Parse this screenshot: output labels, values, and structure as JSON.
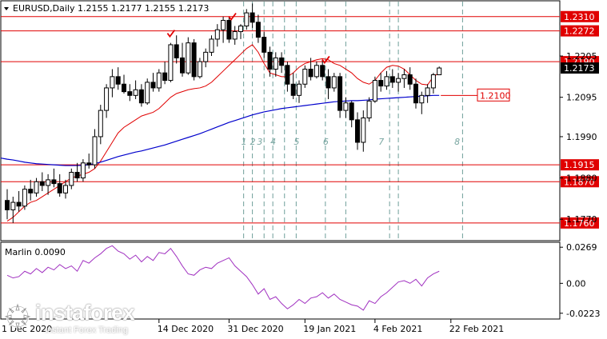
{
  "colors": {
    "background": "#ffffff",
    "axis": "#000000",
    "grid": "#c8c8c8",
    "level_line": "#e00000",
    "level_label_bg": "#e00000",
    "level_label_text": "#ffffff",
    "ma_line": "#0000cc",
    "envelope_line": "#e00000",
    "candle": "#000000",
    "marker": "#e00000",
    "wave_label": "#7aa7a2",
    "oscillator": "#a030c0",
    "price_label_bg": "#000000",
    "price_label_text": "#ffffff"
  },
  "icons": {
    "watermark_logo": "instaforex-logo-icon",
    "peak_marker": "check-mark-icon"
  },
  "chart_data": [
    {
      "type": "candlestick",
      "title": "EURUSD,Daily  1.2155 1.2177 1.2155 1.2173",
      "symbol": "EURUSD",
      "timeframe": "Daily",
      "ohlc_header": {
        "open": 1.2155,
        "high": 1.2177,
        "low": 1.2155,
        "close": 1.2173
      },
      "ylim": [
        1.1715,
        1.235
      ],
      "y_tick_labels": [
        {
          "value": 1.2205,
          "label": "1.2205"
        },
        {
          "value": 1.2095,
          "label": "1.2095"
        },
        {
          "value": 1.199,
          "label": "1.1990"
        },
        {
          "value": 1.188,
          "label": "1.1880"
        },
        {
          "value": 1.177,
          "label": "1.1770"
        }
      ],
      "x_labels": [
        "14 Dec 2020",
        "31 Dec 2020",
        "19 Jan 2021",
        "4 Feb 2021",
        "22 Feb 2021"
      ],
      "x_label_positions": [
        {
          "label": "14 Dec 2020",
          "index": 26
        },
        {
          "label": "31 Dec 2020",
          "index": 38
        },
        {
          "label": "19 Jan 2021",
          "index": 51
        },
        {
          "label": "4 Feb 2021",
          "index": 63
        },
        {
          "label": "22 Feb 2021",
          "index": 76
        }
      ],
      "levels": [
        {
          "value": 1.231,
          "label": "1.2310"
        },
        {
          "value": 1.2272,
          "label": "1.2272"
        },
        {
          "value": 1.219,
          "label": "1.2190"
        },
        {
          "value": 1.1915,
          "label": "1.1915"
        },
        {
          "value": 1.187,
          "label": "1.1870"
        },
        {
          "value": 1.176,
          "label": "1.1760"
        }
      ],
      "ma_label": {
        "value": 1.21,
        "label": "1.2100"
      },
      "last_price": {
        "value": 1.2173,
        "label": "1.2173"
      },
      "vertical_dividers_index": [
        40.5,
        42,
        44,
        45.5,
        47.5,
        49.5,
        54.5,
        58,
        65.5,
        67,
        78
      ],
      "wave_labels": [
        {
          "label": "1",
          "index": 40.5
        },
        {
          "label": "2",
          "index": 42
        },
        {
          "label": "3",
          "index": 43.2
        },
        {
          "label": "4",
          "index": 45.5
        },
        {
          "label": "5",
          "index": 49.5
        },
        {
          "label": "6",
          "index": 54.5
        },
        {
          "label": "7",
          "index": 64
        },
        {
          "label": "8",
          "index": 77
        }
      ],
      "peak_markers_index": [
        28,
        38.5,
        54.5
      ],
      "candles": [
        [
          1.182,
          1.185,
          1.177,
          1.1795
        ],
        [
          1.1795,
          1.183,
          1.176,
          1.1815
        ],
        [
          1.1815,
          1.1845,
          1.179,
          1.1805
        ],
        [
          1.1805,
          1.186,
          1.1795,
          1.185
        ],
        [
          1.185,
          1.1875,
          1.182,
          1.184
        ],
        [
          1.184,
          1.188,
          1.183,
          1.187
        ],
        [
          1.187,
          1.1895,
          1.1845,
          1.186
        ],
        [
          1.186,
          1.189,
          1.1835,
          1.1875
        ],
        [
          1.1875,
          1.1905,
          1.1855,
          1.1865
        ],
        [
          1.1865,
          1.189,
          1.183,
          1.184
        ],
        [
          1.184,
          1.1875,
          1.1825,
          1.186
        ],
        [
          1.186,
          1.1905,
          1.185,
          1.1895
        ],
        [
          1.1895,
          1.192,
          1.187,
          1.188
        ],
        [
          1.188,
          1.193,
          1.187,
          1.192
        ],
        [
          1.192,
          1.1945,
          1.1905,
          1.1915
        ],
        [
          1.1915,
          1.201,
          1.1905,
          1.199
        ],
        [
          1.199,
          1.2075,
          1.197,
          1.206
        ],
        [
          1.206,
          1.213,
          1.204,
          1.212
        ],
        [
          1.212,
          1.217,
          1.2095,
          1.215
        ],
        [
          1.215,
          1.2175,
          1.2115,
          1.213
        ],
        [
          1.213,
          1.2155,
          1.2105,
          1.211
        ],
        [
          1.211,
          1.213,
          1.2085,
          1.21
        ],
        [
          1.21,
          1.214,
          1.209,
          1.2115
        ],
        [
          1.2115,
          1.213,
          1.207,
          1.208
        ],
        [
          1.208,
          1.2145,
          1.2075,
          1.2135
        ],
        [
          1.2135,
          1.216,
          1.211,
          1.212
        ],
        [
          1.212,
          1.217,
          1.211,
          1.216
        ],
        [
          1.216,
          1.219,
          1.213,
          1.214
        ],
        [
          1.214,
          1.224,
          1.2135,
          1.2235
        ],
        [
          1.2235,
          1.226,
          1.2185,
          1.22
        ],
        [
          1.22,
          1.224,
          1.215,
          1.216
        ],
        [
          1.216,
          1.2255,
          1.2155,
          1.224
        ],
        [
          1.224,
          1.225,
          1.214,
          1.215
        ],
        [
          1.215,
          1.22,
          1.2145,
          1.219
        ],
        [
          1.219,
          1.2225,
          1.2175,
          1.2215
        ],
        [
          1.2215,
          1.226,
          1.2205,
          1.225
        ],
        [
          1.225,
          1.229,
          1.223,
          1.2275
        ],
        [
          1.2275,
          1.231,
          1.224,
          1.23
        ],
        [
          1.23,
          1.2308,
          1.224,
          1.225
        ],
        [
          1.225,
          1.2285,
          1.2235,
          1.227
        ],
        [
          1.227,
          1.229,
          1.225,
          1.2285
        ],
        [
          1.2285,
          1.233,
          1.2275,
          1.232
        ],
        [
          1.232,
          1.2345,
          1.228,
          1.2295
        ],
        [
          1.2295,
          1.2315,
          1.224,
          1.2255
        ],
        [
          1.2255,
          1.227,
          1.22,
          1.2215
        ],
        [
          1.2215,
          1.223,
          1.215,
          1.217
        ],
        [
          1.217,
          1.2215,
          1.215,
          1.22
        ],
        [
          1.22,
          1.2215,
          1.216,
          1.218
        ],
        [
          1.218,
          1.219,
          1.211,
          1.213
        ],
        [
          1.213,
          1.216,
          1.209,
          1.21
        ],
        [
          1.21,
          1.214,
          1.208,
          1.213
        ],
        [
          1.213,
          1.218,
          1.212,
          1.217
        ],
        [
          1.217,
          1.22,
          1.214,
          1.215
        ],
        [
          1.215,
          1.219,
          1.2145,
          1.218
        ],
        [
          1.218,
          1.2195,
          1.214,
          1.215
        ],
        [
          1.215,
          1.217,
          1.209,
          1.212
        ],
        [
          1.212,
          1.216,
          1.211,
          1.215
        ],
        [
          1.215,
          1.216,
          1.204,
          1.206
        ],
        [
          1.206,
          1.2095,
          1.204,
          1.208
        ],
        [
          1.208,
          1.2085,
          1.2015,
          1.2035
        ],
        [
          1.2035,
          1.2055,
          1.1955,
          1.1975
        ],
        [
          1.1975,
          1.206,
          1.195,
          1.204
        ],
        [
          1.204,
          1.2095,
          1.203,
          1.2085
        ],
        [
          1.2085,
          1.215,
          1.208,
          1.214
        ],
        [
          1.214,
          1.216,
          1.211,
          1.2125
        ],
        [
          1.2125,
          1.2165,
          1.2115,
          1.215
        ],
        [
          1.215,
          1.217,
          1.212,
          1.2135
        ],
        [
          1.2135,
          1.216,
          1.211,
          1.2145
        ],
        [
          1.2145,
          1.217,
          1.212,
          1.2155
        ],
        [
          1.2155,
          1.2175,
          1.2115,
          1.213
        ],
        [
          1.213,
          1.2145,
          1.2065,
          1.208
        ],
        [
          1.208,
          1.211,
          1.205,
          1.21
        ],
        [
          1.21,
          1.213,
          1.208,
          1.212
        ],
        [
          1.212,
          1.216,
          1.2105,
          1.2155
        ],
        [
          1.2155,
          1.2177,
          1.2155,
          1.2173
        ]
      ],
      "ma_line": [
        1.193,
        1.1928,
        1.1925,
        1.1922,
        1.192,
        1.1918,
        1.1917,
        1.1916,
        1.1915,
        1.1914,
        1.1913,
        1.1913,
        1.1913,
        1.1914,
        1.1915,
        1.1918,
        1.1922,
        1.1927,
        1.1932,
        1.1937,
        1.1941,
        1.1945,
        1.1949,
        1.1952,
        1.1956,
        1.196,
        1.1964,
        1.1968,
        1.1973,
        1.1978,
        1.1983,
        1.1988,
        1.1993,
        1.1998,
        1.2004,
        1.201,
        1.2016,
        1.2022,
        1.2028,
        1.2033,
        1.2038,
        1.2043,
        1.2048,
        1.2052,
        1.2056,
        1.2059,
        1.2062,
        1.2065,
        1.2067,
        1.2069,
        1.2071,
        1.2073,
        1.2075,
        1.2077,
        1.2079,
        1.2081,
        1.2083,
        1.2084,
        1.2085,
        1.2086,
        1.2086,
        1.2087,
        1.2088,
        1.209,
        1.2091,
        1.2092,
        1.2093,
        1.2094,
        1.2095,
        1.2096,
        1.2097,
        1.2098,
        1.2099,
        1.21,
        1.21
      ],
      "envelope_line": [
        1.1765,
        1.1775,
        1.179,
        1.1805,
        1.1815,
        1.182,
        1.183,
        1.184,
        1.185,
        1.186,
        1.187,
        1.188,
        1.1885,
        1.189,
        1.1895,
        1.1905,
        1.1925,
        1.195,
        1.1975,
        1.2,
        1.2015,
        1.2025,
        1.2035,
        1.2045,
        1.205,
        1.2055,
        1.2065,
        1.208,
        1.2095,
        1.2105,
        1.211,
        1.2115,
        1.2118,
        1.212,
        1.2125,
        1.2135,
        1.215,
        1.2165,
        1.218,
        1.2195,
        1.221,
        1.2225,
        1.2235,
        1.2215,
        1.2185,
        1.216,
        1.2155,
        1.215,
        1.215,
        1.216,
        1.2175,
        1.2185,
        1.219,
        1.2195,
        1.2198,
        1.2195,
        1.2185,
        1.218,
        1.217,
        1.216,
        1.2145,
        1.2135,
        1.213,
        1.214,
        1.216,
        1.2175,
        1.218,
        1.2178,
        1.217,
        1.2155,
        1.214,
        1.213,
        1.2128,
        1.215,
        1.216
      ]
    },
    {
      "type": "line",
      "title": "Marlin 0.0090",
      "series": [
        {
          "name": "Marlin",
          "values": [
            0.006,
            0.004,
            0.005,
            0.009,
            0.007,
            0.011,
            0.008,
            0.012,
            0.01,
            0.014,
            0.011,
            0.013,
            0.009,
            0.017,
            0.015,
            0.019,
            0.022,
            0.026,
            0.028,
            0.024,
            0.022,
            0.018,
            0.021,
            0.016,
            0.02,
            0.017,
            0.023,
            0.022,
            0.026,
            0.02,
            0.013,
            0.007,
            0.006,
            0.01,
            0.012,
            0.011,
            0.015,
            0.017,
            0.019,
            0.013,
            0.009,
            0.005,
            -0.001,
            -0.008,
            -0.004,
            -0.012,
            -0.01,
            -0.015,
            -0.019,
            -0.016,
            -0.012,
            -0.015,
            -0.011,
            -0.01,
            -0.007,
            -0.011,
            -0.008,
            -0.012,
            -0.014,
            -0.016,
            -0.017,
            -0.02,
            -0.013,
            -0.015,
            -0.01,
            -0.007,
            -0.003,
            0.001,
            0.002,
            0.0,
            0.003,
            -0.002,
            0.004,
            0.007,
            0.009
          ]
        }
      ],
      "ylim": [
        -0.026,
        0.03
      ],
      "y_tick_labels": [
        {
          "value": 0.0269,
          "label": "0.0269"
        },
        {
          "value": 0.0,
          "label": "0.00"
        },
        {
          "value": -0.0223,
          "label": "-0.0223"
        }
      ]
    }
  ],
  "watermark": {
    "name": "instaforex",
    "tagline": "Instant Forex Trading"
  },
  "partial_x_label": "1 Dec 2020"
}
